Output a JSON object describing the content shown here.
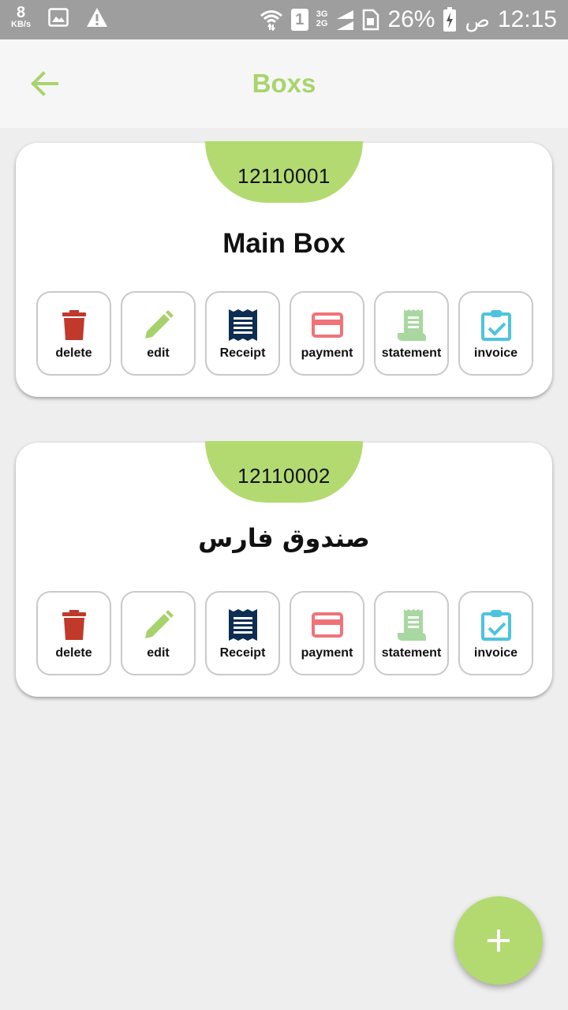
{
  "status_bar": {
    "speed_value": "8",
    "speed_unit": "KB/s",
    "net_top": "3G",
    "net_bottom": "2G",
    "sim": "1",
    "battery": "26%",
    "ampm": "ص",
    "time": "12:15"
  },
  "app_bar": {
    "title": "Boxs"
  },
  "boxes": [
    {
      "code": "12110001",
      "name": "Main Box",
      "actions": {
        "delete": "delete",
        "edit": "edit",
        "receipt": "Receipt",
        "payment": "payment",
        "statement": "statement",
        "invoice": "invoice"
      }
    },
    {
      "code": "12110002",
      "name": "صندوق فارس",
      "actions": {
        "delete": "delete",
        "edit": "edit",
        "receipt": "Receipt",
        "payment": "payment",
        "statement": "statement",
        "invoice": "invoice"
      }
    }
  ],
  "fab_icon": "plus-icon",
  "colors": {
    "accent": "#b2da71",
    "title": "#a8d46c",
    "delete": "#c0392b",
    "edit": "#a5d26a",
    "receipt": "#0d2d52",
    "payment": "#f07379",
    "statement": "#a8d8a0",
    "invoice": "#4ec3dd"
  }
}
